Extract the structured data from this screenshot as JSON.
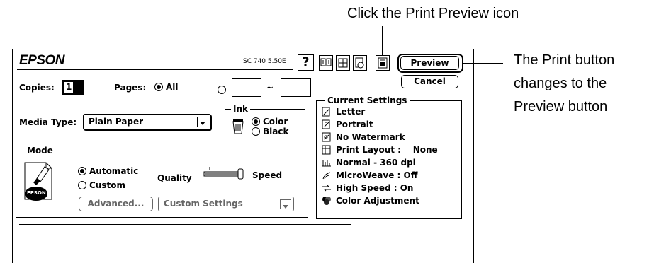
{
  "annotations": {
    "top": "Click the Print Preview icon",
    "right": [
      "The Print button",
      "changes to the",
      "Preview button"
    ]
  },
  "dialog": {
    "brand": "EPSON",
    "model": "SC 740 5.50E",
    "help_label": "?",
    "preview_button": "Preview",
    "cancel_button": "Cancel",
    "copies_label": "Copies:",
    "copies_value": "1",
    "pages_label": "Pages:",
    "pages_all": "All",
    "pages_from": "",
    "pages_tilde": "~",
    "pages_to": "",
    "media_label": "Media Type:",
    "media_value": "Plain Paper",
    "ink_group": "Ink",
    "ink_color": "Color",
    "ink_black": "Black",
    "mode_group": "Mode",
    "mode_automatic": "Automatic",
    "mode_custom": "Custom",
    "quality_label": "Quality",
    "speed_label": "Speed",
    "advanced_button": "Advanced...",
    "custom_settings": "Custom Settings",
    "epson_logo": "EPSON",
    "current_settings": {
      "title": "Current Settings",
      "items": [
        {
          "label": "Letter",
          "icon": "paper-size-icon"
        },
        {
          "label": "Portrait",
          "icon": "orientation-icon"
        },
        {
          "label": "No Watermark",
          "icon": "watermark-icon"
        },
        {
          "label": "Print Layout :    None",
          "icon": "layout-icon"
        },
        {
          "label": "Normal - 360 dpi",
          "icon": "resolution-icon"
        },
        {
          "label": "MicroWeave : Off",
          "icon": "microweave-icon"
        },
        {
          "label": "High Speed : On",
          "icon": "high-speed-icon"
        },
        {
          "label": "Color Adjustment",
          "icon": "color-adjust-icon"
        }
      ]
    }
  }
}
